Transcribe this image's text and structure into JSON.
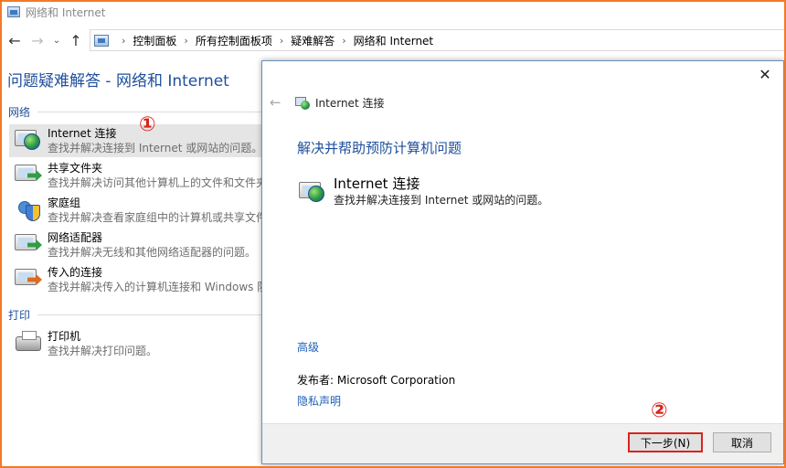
{
  "window": {
    "title": "网络和 Internet"
  },
  "address": {
    "crumbs": [
      "控制面板",
      "所有控制面板项",
      "疑难解答",
      "网络和 Internet"
    ]
  },
  "page": {
    "title": "问题疑难解答 - 网络和 Internet"
  },
  "groups": [
    {
      "label": "网络",
      "items": [
        {
          "name": "Internet 连接",
          "desc": "查找并解决连接到 Internet 或网站的问题。",
          "icon": "internet-connection-icon",
          "selected": true
        },
        {
          "name": "共享文件夹",
          "desc": "查找并解决访问其他计算机上的文件和文件夹",
          "icon": "shared-folders-icon"
        },
        {
          "name": "家庭组",
          "desc": "查找并解决查看家庭组中的计算机或共享文件",
          "icon": "homegroup-icon"
        },
        {
          "name": "网络适配器",
          "desc": "查找并解决无线和其他网络适配器的问题。",
          "icon": "network-adapter-icon"
        },
        {
          "name": "传入的连接",
          "desc": "查找并解决传入的计算机连接和 Windows 防",
          "icon": "incoming-connections-icon"
        }
      ]
    },
    {
      "label": "打印",
      "items": [
        {
          "name": "打印机",
          "desc": "查找并解决打印问题。",
          "icon": "printer-icon"
        }
      ]
    }
  ],
  "annotations": {
    "step1": "①",
    "step2": "②"
  },
  "dialog": {
    "title": "Internet 连接",
    "heading": "解决并帮助预防计算机问题",
    "tool_name": "Internet 连接",
    "tool_desc": "查找并解决连接到 Internet 或网站的问题。",
    "advanced_link": "高级",
    "publisher": "发布者:  Microsoft Corporation",
    "privacy_link": "隐私声明",
    "next_button": "下一步(N)",
    "cancel_button": "取消"
  },
  "colors": {
    "accent": "#1e4f9b",
    "link": "#1e5eb8",
    "marker": "#d9241b",
    "frame": "#f07a2a"
  }
}
